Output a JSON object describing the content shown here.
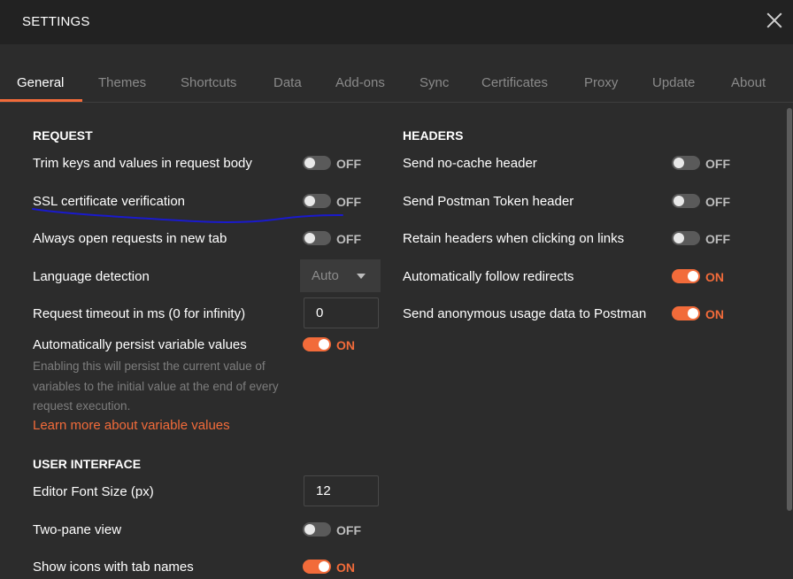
{
  "window": {
    "title": "SETTINGS"
  },
  "tabs": [
    {
      "label": "General",
      "active": true
    },
    {
      "label": "Themes"
    },
    {
      "label": "Shortcuts"
    },
    {
      "label": "Data"
    },
    {
      "label": "Add-ons"
    },
    {
      "label": "Sync"
    },
    {
      "label": "Certificates"
    },
    {
      "label": "Proxy"
    },
    {
      "label": "Update"
    },
    {
      "label": "About"
    }
  ],
  "request": {
    "title": "REQUEST",
    "trim_keys": {
      "label": "Trim keys and values in request body",
      "state": "OFF"
    },
    "ssl_verification": {
      "label": "SSL certificate verification",
      "state": "OFF"
    },
    "open_new_tab": {
      "label": "Always open requests in new tab",
      "state": "OFF"
    },
    "language_detection": {
      "label": "Language detection",
      "value": "Auto"
    },
    "request_timeout": {
      "label": "Request timeout in ms (0 for infinity)",
      "value": "0"
    },
    "persist_variables": {
      "label": "Automatically persist variable values",
      "state": "ON",
      "help": "Enabling this will persist the current value of variables to the initial value at the end of every request execution.",
      "link": "Learn more about variable values"
    }
  },
  "headers": {
    "title": "HEADERS",
    "no_cache": {
      "label": "Send no-cache header",
      "state": "OFF"
    },
    "postman_token": {
      "label": "Send Postman Token header",
      "state": "OFF"
    },
    "retain_headers": {
      "label": "Retain headers when clicking on links",
      "state": "OFF"
    },
    "follow_redirects": {
      "label": "Automatically follow redirects",
      "state": "ON"
    },
    "anonymous_usage": {
      "label": "Send anonymous usage data to Postman",
      "state": "ON"
    }
  },
  "user_interface": {
    "title": "USER INTERFACE",
    "editor_font_size": {
      "label": "Editor Font Size (px)",
      "value": "12"
    },
    "two_pane_view": {
      "label": "Two-pane view",
      "state": "OFF"
    },
    "show_icons": {
      "label": "Show icons with tab names",
      "state": "ON"
    }
  },
  "colors": {
    "accent": "#f26b3a",
    "background": "#2c2c2c",
    "titlebar": "#222222",
    "annotation": "#1a1acc"
  }
}
